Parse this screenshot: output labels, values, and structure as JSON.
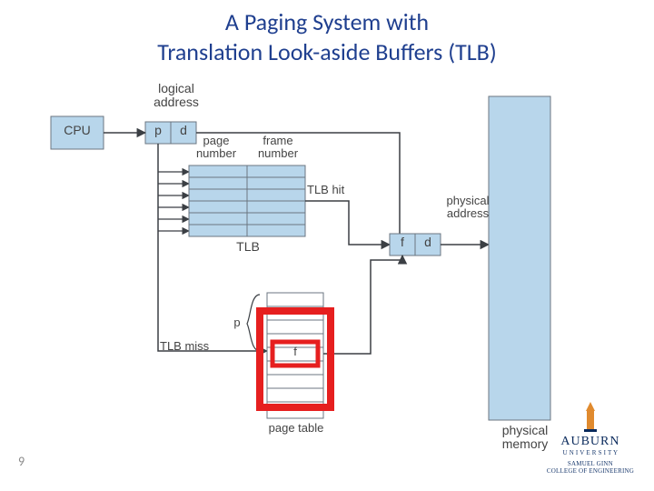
{
  "title_line1": "A Paging System with",
  "title_line2": "Translation Look-aside Buffers (TLB)",
  "slide_number": "9",
  "labels": {
    "logical_address": "logical\naddress",
    "cpu": "CPU",
    "p": "p",
    "d": "d",
    "page_number": "page\nnumber",
    "frame_number": "frame\nnumber",
    "tlb": "TLB",
    "tlb_hit": "TLB hit",
    "tlb_miss": "TLB miss",
    "f": "f",
    "d2": "d",
    "p_brace": "p",
    "f_pt": "f",
    "page_table": "page table",
    "physical_address": "physical\naddress",
    "physical_memory": "physical\nmemory"
  },
  "colors": {
    "box_fill": "#b8d6eb",
    "box_stroke": "#6b7680",
    "line": "#3b3f44",
    "highlight": "#e61f1f",
    "title": "#1f3f8f",
    "logo_navy": "#0a2a5c",
    "logo_orange": "#e08a2e"
  },
  "footer": {
    "university": "AUBURN",
    "subtext1": "U N I V E R S I T Y",
    "college_line1": "SAMUEL GINN",
    "college_line2": "COLLEGE OF ENGINEERING"
  },
  "diagram_semantics": {
    "description": "Paging hardware with TLB: CPU emits logical address (p,d). TLB is checked with page number p; on TLB hit, frame f is used directly. On TLB miss, page table is indexed with p to obtain frame f. Either way, (f,d) forms physical address used to access physical memory.",
    "tlb_rows": 6,
    "page_table_rows": 9,
    "highlighted_page_table_region": "rows around entry f (TLB-miss lookup result)"
  }
}
